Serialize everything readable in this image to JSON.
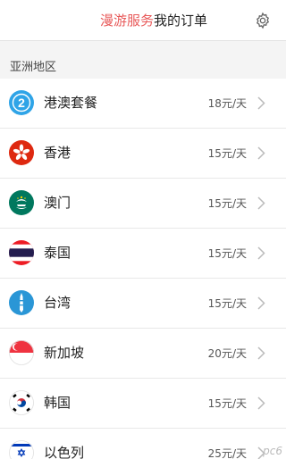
{
  "header": {
    "tabs": [
      {
        "label": "漫游服务",
        "active": true
      },
      {
        "label": "我的订单",
        "active": false
      }
    ],
    "settings_icon": "gear-icon"
  },
  "section": {
    "label": "亚洲地区"
  },
  "packages": [
    {
      "name": "港澳套餐",
      "price": "18元/天",
      "icon": "number-2-badge-icon"
    },
    {
      "name": "香港",
      "price": "15元/天",
      "icon": "hong-kong-flag-icon"
    },
    {
      "name": "澳门",
      "price": "15元/天",
      "icon": "macau-flag-icon"
    },
    {
      "name": "泰国",
      "price": "15元/天",
      "icon": "thailand-flag-icon"
    },
    {
      "name": "台湾",
      "price": "15元/天",
      "icon": "taiwan-icon"
    },
    {
      "name": "新加坡",
      "price": "20元/天",
      "icon": "singapore-flag-icon"
    },
    {
      "name": "韩国",
      "price": "15元/天",
      "icon": "south-korea-flag-icon"
    },
    {
      "name": "以色列",
      "price": "25元/天",
      "icon": "israel-flag-icon"
    }
  ],
  "colors": {
    "accent": "#e85a5a",
    "divider": "#e8e8e8",
    "background": "#f4f4f4"
  },
  "watermark": "pc6"
}
